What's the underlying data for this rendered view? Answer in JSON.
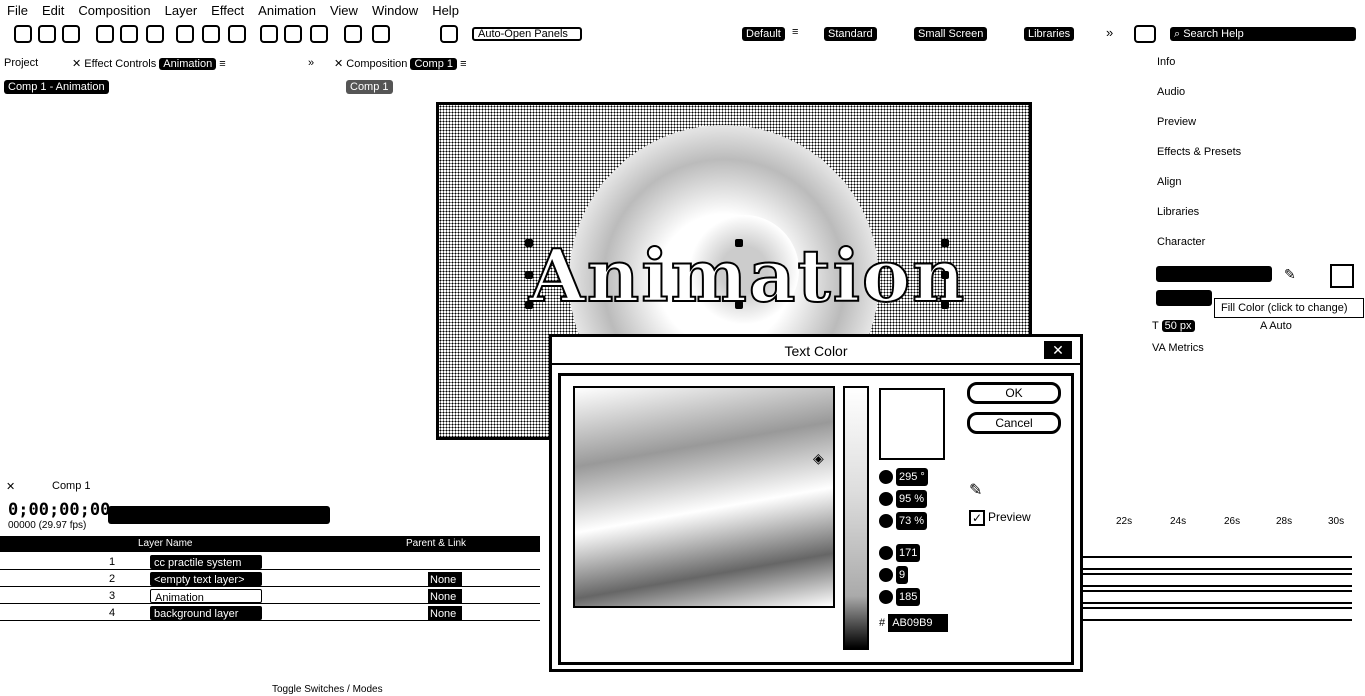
{
  "menu": [
    "File",
    "Edit",
    "Composition",
    "Layer",
    "Effect",
    "Animation",
    "View",
    "Window",
    "Help"
  ],
  "toolbar": {
    "auto_open": "Auto-Open Panels",
    "workspaces": [
      "Default",
      "Standard",
      "Small Screen",
      "Libraries"
    ],
    "search_help": "Search Help"
  },
  "panels": {
    "project_tab": "Project",
    "effect_controls_tab": "Effect Controls",
    "effect_controls_target": "Animation",
    "composition_tab": "Composition",
    "composition_name": "Comp 1",
    "breadcrumb": "Comp 1 - Animation",
    "comp_tab": "Comp 1"
  },
  "composition": {
    "text": "Animation"
  },
  "right_panel": {
    "items": [
      "Info",
      "Audio",
      "Preview",
      "Effects & Presets",
      "Align",
      "Libraries",
      "Character"
    ],
    "tooltip": "Fill Color (click to change)",
    "font_size": "50 px",
    "kerning": "Metrics",
    "leading": "Auto"
  },
  "timeline": {
    "comp_tab": "Comp 1",
    "timecode": "0;00;00;00",
    "fps": "00000 (29.97 fps)",
    "columns": {
      "layer_name": "Layer Name",
      "parent": "Parent & Link"
    },
    "layers": [
      {
        "num": "1",
        "name": "cc practile system",
        "parent": ""
      },
      {
        "num": "2",
        "name": "<empty text layer>",
        "parent": "None"
      },
      {
        "num": "3",
        "name": "Animation",
        "parent": "None"
      },
      {
        "num": "4",
        "name": "background layer",
        "parent": "None"
      }
    ],
    "ruler": [
      "22s",
      "24s",
      "26s",
      "28s",
      "30s"
    ],
    "toggle": "Toggle Switches / Modes"
  },
  "dialog": {
    "title": "Text Color",
    "ok": "OK",
    "cancel": "Cancel",
    "fields": {
      "H": "295 °",
      "S": "95 %",
      "B": "73 %",
      "R": "171",
      "G": "9",
      "Bv": "185"
    },
    "hex": "AB09B9",
    "preview_label": "Preview",
    "preview_checked": true
  }
}
